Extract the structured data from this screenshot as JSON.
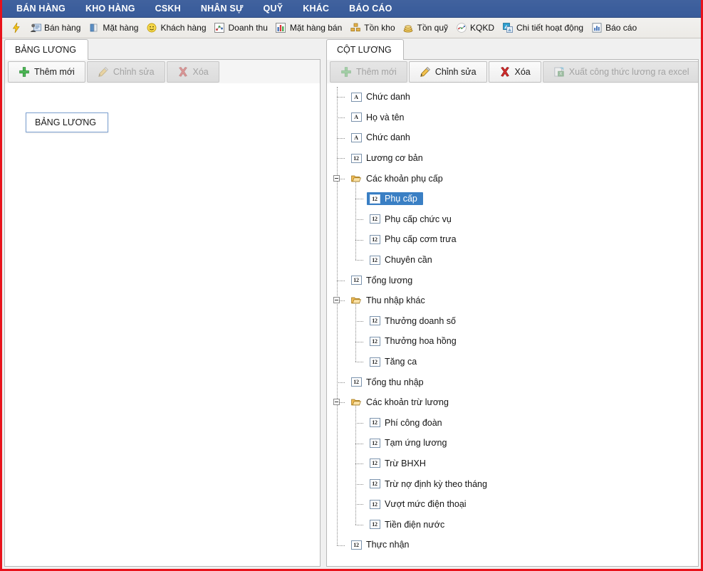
{
  "menubar": {
    "items": [
      {
        "label": "BÁN HÀNG"
      },
      {
        "label": "KHO HÀNG"
      },
      {
        "label": "CSKH"
      },
      {
        "label": "NHÂN SỰ"
      },
      {
        "label": "QUỸ"
      },
      {
        "label": "KHÁC"
      },
      {
        "label": "BÁO CÁO"
      }
    ]
  },
  "toolbar": {
    "items": [
      {
        "icon": "lightning-icon",
        "label": ""
      },
      {
        "icon": "sales-person-icon",
        "label": "Bán hàng"
      },
      {
        "icon": "product-box-icon",
        "label": "Mặt hàng"
      },
      {
        "icon": "customer-smiley-icon",
        "label": "Khách hàng"
      },
      {
        "icon": "revenue-scatter-icon",
        "label": "Doanh thu"
      },
      {
        "icon": "bar-chart-icon",
        "label": "Mặt hàng bán"
      },
      {
        "icon": "inventory-boxes-icon",
        "label": "Tồn kho"
      },
      {
        "icon": "coins-stack-icon",
        "label": "Tồn quỹ"
      },
      {
        "icon": "line-chart-icon",
        "label": "KQKD"
      },
      {
        "icon": "activity-detail-icon",
        "label": "Chi tiết hoạt động"
      },
      {
        "icon": "report-chart-icon",
        "label": "Báo cáo"
      }
    ]
  },
  "left_panel": {
    "tab_label": "BẢNG LƯƠNG",
    "buttons": [
      {
        "name": "add-new",
        "label": "Thêm mới",
        "icon": "plus-icon",
        "disabled": false
      },
      {
        "name": "edit",
        "label": "Chỉnh sửa",
        "icon": "pencil-icon",
        "disabled": true
      },
      {
        "name": "delete",
        "label": "Xóa",
        "icon": "x-mark-icon",
        "disabled": true
      }
    ],
    "tooltip": "BẢNG LƯƠNG"
  },
  "right_panel": {
    "tab_label": "CỘT LƯƠNG",
    "buttons": [
      {
        "name": "add-new",
        "label": "Thêm mới",
        "icon": "plus-icon",
        "disabled": true
      },
      {
        "name": "edit",
        "label": "Chỉnh sửa",
        "icon": "pencil-icon",
        "disabled": false
      },
      {
        "name": "delete",
        "label": "Xóa",
        "icon": "x-mark-icon",
        "disabled": false
      },
      {
        "name": "export-excel",
        "label": "Xuất công thức lương ra excel",
        "icon": "excel-export-icon",
        "disabled": true
      }
    ],
    "tree": [
      {
        "label": "Chức danh",
        "icon": "text-field-icon",
        "depth": 0,
        "type": "leaf",
        "selected": false
      },
      {
        "label": "Họ và tên",
        "icon": "text-field-icon",
        "depth": 0,
        "type": "leaf",
        "selected": false
      },
      {
        "label": "Chức danh",
        "icon": "text-field-icon",
        "depth": 0,
        "type": "leaf",
        "selected": false
      },
      {
        "label": "Lương cơ bản",
        "icon": "number-field-icon",
        "depth": 0,
        "type": "leaf",
        "selected": false
      },
      {
        "label": "Các khoản phụ cấp",
        "icon": "folder-icon",
        "depth": 0,
        "type": "folder",
        "selected": false
      },
      {
        "label": "Phụ cấp",
        "icon": "number-field-icon",
        "depth": 1,
        "type": "leaf",
        "selected": true
      },
      {
        "label": "Phụ cấp chức vụ",
        "icon": "number-field-icon",
        "depth": 1,
        "type": "leaf",
        "selected": false
      },
      {
        "label": "Phụ cấp cơm trưa",
        "icon": "number-field-icon",
        "depth": 1,
        "type": "leaf",
        "selected": false
      },
      {
        "label": "Chuyên cần",
        "icon": "number-field-icon",
        "depth": 1,
        "type": "leaf",
        "selected": false,
        "last_child": true
      },
      {
        "label": "Tổng lương",
        "icon": "number-field-icon",
        "depth": 0,
        "type": "leaf",
        "selected": false
      },
      {
        "label": "Thu nhập khác",
        "icon": "folder-icon",
        "depth": 0,
        "type": "folder",
        "selected": false
      },
      {
        "label": "Thưởng doanh số",
        "icon": "number-field-icon",
        "depth": 1,
        "type": "leaf",
        "selected": false
      },
      {
        "label": "Thưởng hoa hồng",
        "icon": "number-field-icon",
        "depth": 1,
        "type": "leaf",
        "selected": false
      },
      {
        "label": "Tăng ca",
        "icon": "number-field-icon",
        "depth": 1,
        "type": "leaf",
        "selected": false,
        "last_child": true
      },
      {
        "label": "Tổng thu nhập",
        "icon": "number-field-icon",
        "depth": 0,
        "type": "leaf",
        "selected": false
      },
      {
        "label": "Các khoản trừ lương",
        "icon": "folder-icon",
        "depth": 0,
        "type": "folder",
        "selected": false
      },
      {
        "label": "Phí công đoàn",
        "icon": "number-field-icon",
        "depth": 1,
        "type": "leaf",
        "selected": false
      },
      {
        "label": "Tạm ứng lương",
        "icon": "number-field-icon",
        "depth": 1,
        "type": "leaf",
        "selected": false
      },
      {
        "label": "Trừ BHXH",
        "icon": "number-field-icon",
        "depth": 1,
        "type": "leaf",
        "selected": false
      },
      {
        "label": "Trừ nợ định kỳ theo tháng",
        "icon": "number-field-icon",
        "depth": 1,
        "type": "leaf",
        "selected": false
      },
      {
        "label": "Vượt mức điện thoại",
        "icon": "number-field-icon",
        "depth": 1,
        "type": "leaf",
        "selected": false
      },
      {
        "label": "Tiền điện nước",
        "icon": "number-field-icon",
        "depth": 1,
        "type": "leaf",
        "selected": false,
        "last_child": true
      },
      {
        "label": "Thực nhận",
        "icon": "number-field-icon",
        "depth": 0,
        "type": "leaf",
        "selected": false,
        "last_root": true
      }
    ]
  },
  "colors": {
    "menubar_bg": "#3c5e9c",
    "window_border": "#e8121b",
    "selection_bg": "#3a7fc4",
    "panel_bg": "#f0f0f0",
    "badge_text": "#1c1c1c"
  }
}
